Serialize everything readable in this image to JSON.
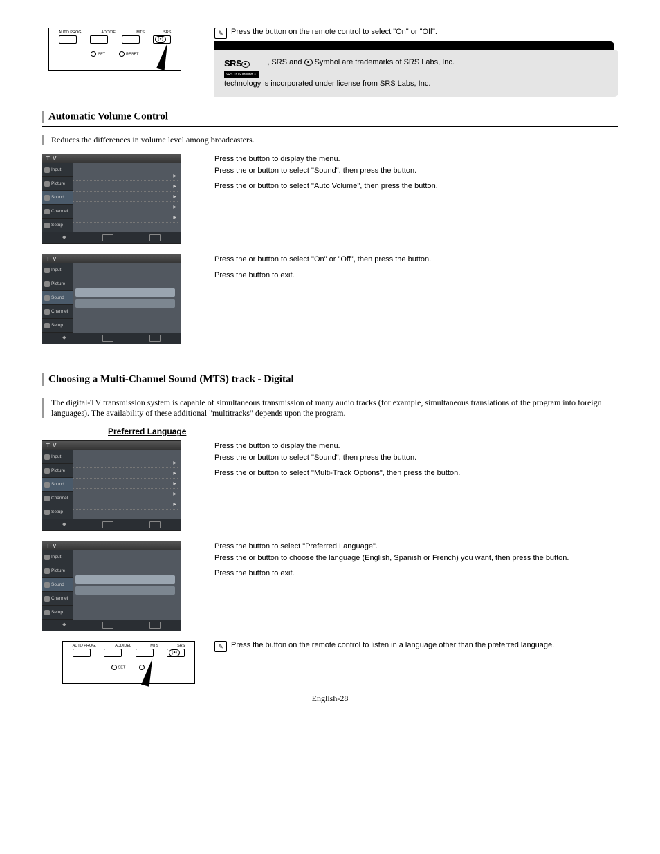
{
  "remote": {
    "labels": [
      "AUTO PROG.",
      "ADD/DEL",
      "MTS",
      "SRS"
    ],
    "bottom": [
      "SET",
      "RESET"
    ]
  },
  "note1": {
    "text_a": "Press the ",
    "text_b": " button on the remote control to select \"On\" or \"Off\"."
  },
  "srsBox": {
    "line1_b": ", SRS and ",
    "line1_c": " Symbol are trademarks of SRS Labs, Inc.",
    "line2": " technology is incorporated under license from SRS Labs, Inc."
  },
  "section2": {
    "title": "Automatic Volume Control",
    "intro": "Reduces the differences in volume level among broadcasters.",
    "steps1": {
      "s1": "Press the ",
      "s1b": " button to display the menu.",
      "s2": "Press the ",
      "s2mid": " or ",
      "s2b": " button to select \"Sound\", then press the ",
      "s2c": " button.",
      "s3": "Press the ",
      "s3mid": " or ",
      "s3b": " button to select \"Auto Volume\", then press the ",
      "s3c": " button."
    },
    "steps2": {
      "s4": "Press the ",
      "s4mid": " or ",
      "s4b": " button to select \"On\" or \"Off\", then press the ",
      "s4c": " button.",
      "s5": "Press the ",
      "s5b": " button to exit."
    }
  },
  "section3": {
    "title": "Choosing a Multi-Channel Sound (MTS) track - Digital",
    "intro": "The digital-TV transmission system is capable of simultaneous transmission of many audio tracks (for example, simultaneous translations of the program into foreign languages). The availability of these additional \"multitracks\" depends upon the program.",
    "subhead": "Preferred Language",
    "steps1": {
      "s1": "Press the ",
      "s1b": " button to display the menu.",
      "s2": "Press the ",
      "s2mid": " or ",
      "s2b": " button to select \"Sound\", then press the ",
      "s2c": " button.",
      "s3": "Press the ",
      "s3mid": " or ",
      "s3b": " button to select \"Multi-Track Options\", then press the ",
      "s3c": " button."
    },
    "steps2": {
      "s4": "Press the ",
      "s4b": " button to select \"Preferred Language\".",
      "s5": "Press the ",
      "s5mid": " or ",
      "s5b": " button to choose the language (English, Spanish or French) you want, then press the ",
      "s5c": " button.",
      "s6": "Press the ",
      "s6b": " button to exit."
    },
    "note": {
      "a": "Press the ",
      "b": " button on the remote control to listen in a language other than the preferred language."
    }
  },
  "menu": {
    "header": "T V",
    "side": [
      "Input",
      "Picture",
      "Sound",
      "Channel",
      "Setup"
    ]
  },
  "pageNum": "English-28"
}
